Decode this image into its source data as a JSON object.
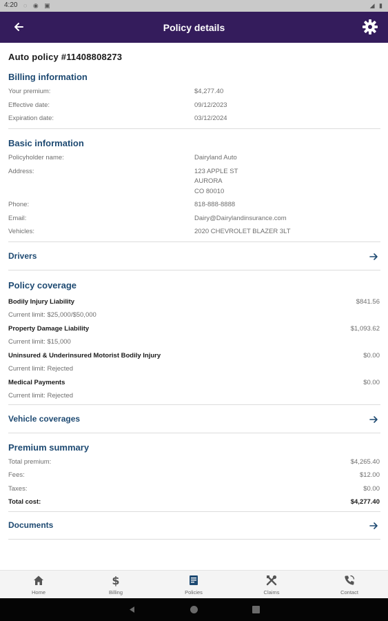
{
  "status_bar": {
    "time": "4:20",
    "left_icons": "◌ ◉ ▣",
    "right_icons": "◢ ▮"
  },
  "app_bar": {
    "title": "Policy details"
  },
  "policy": {
    "title": "Auto policy #11408808273"
  },
  "billing": {
    "title": "Billing information",
    "rows": [
      {
        "label": "Your premium:",
        "value": "$4,277.40"
      },
      {
        "label": "Effective date:",
        "value": "09/12/2023"
      },
      {
        "label": "Expiration date:",
        "value": "03/12/2024"
      }
    ]
  },
  "basic": {
    "title": "Basic information",
    "policyholder_label": "Policyholder name:",
    "policyholder_value": "Dairyland  Auto",
    "address_label": "Address:",
    "address_line1": "123 APPLE ST",
    "address_line2": "AURORA",
    "address_line3": "CO 80010",
    "phone_label": "Phone:",
    "phone_value": "818-888-8888",
    "email_label": "Email:",
    "email_value": "Dairy@Dairylandinsurance.com",
    "vehicles_label": "Vehicles:",
    "vehicles_value": "2020 CHEVROLET BLAZER 3LT"
  },
  "links": {
    "drivers": "Drivers",
    "vehicle_coverages": "Vehicle coverages",
    "documents": "Documents"
  },
  "coverage": {
    "title": "Policy coverage",
    "items": [
      {
        "name": "Bodily Injury Liability",
        "limit": "Current limit: $25,000/$50,000",
        "amount": "$841.56"
      },
      {
        "name": "Property Damage Liability",
        "limit": "Current limit: $15,000",
        "amount": "$1,093.62"
      },
      {
        "name": "Uninsured & Underinsured Motorist Bodily Injury",
        "limit": "Current limit: Rejected",
        "amount": "$0.00"
      },
      {
        "name": "Medical Payments",
        "limit": "Current limit: Rejected",
        "amount": "$0.00"
      }
    ]
  },
  "premium_summary": {
    "title": "Premium summary",
    "rows": [
      {
        "label": "Total premium:",
        "value": "$4,265.40"
      },
      {
        "label": "Fees:",
        "value": "$12.00"
      },
      {
        "label": "Taxes:",
        "value": "$0.00"
      },
      {
        "label": "Total cost:",
        "value": "$4,277.40"
      }
    ]
  },
  "bottom_nav": {
    "items": [
      {
        "label": "Home",
        "icon": "home-icon"
      },
      {
        "label": "Billing",
        "icon": "dollar-icon"
      },
      {
        "label": "Policies",
        "icon": "policy-document-icon"
      },
      {
        "label": "Claims",
        "icon": "tools-icon"
      },
      {
        "label": "Contact",
        "icon": "phone-icon"
      }
    ]
  },
  "colors": {
    "app_bar": "#341c5c",
    "section_title": "#1e4a72",
    "active_nav": "#1e4a72"
  }
}
